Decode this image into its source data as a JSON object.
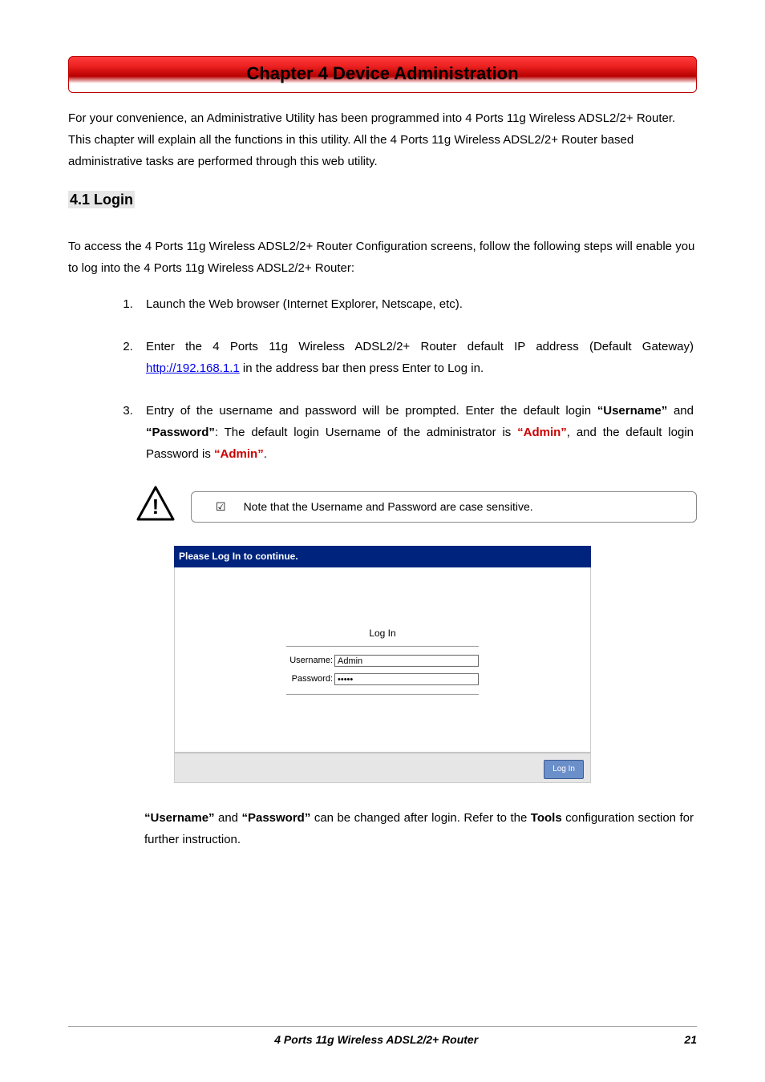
{
  "chapter_title": "Chapter 4 Device Administration",
  "intro_para": "For your convenience, an Administrative Utility has been programmed into 4 Ports 11g Wireless ADSL2/2+ Router. This chapter will explain all the functions in this utility. All the 4 Ports 11g Wireless ADSL2/2+ Router based administrative tasks are performed through this web utility.",
  "section_4_1_title": "4.1 Login",
  "section_4_1_intro": "To access the 4 Ports 11g Wireless ADSL2/2+ Router Configuration screens, follow the following steps will enable you to log into the 4 Ports 11g Wireless ADSL2/2+ Router:",
  "steps": {
    "s1": "Launch the Web browser (Internet Explorer, Netscape, etc).",
    "s2_pre": "Enter the 4 Ports 11g Wireless ADSL2/2+ Router default IP address (Default Gateway) ",
    "s2_link": "http://192.168.1.1",
    "s2_post": " in the address bar then press Enter to Log in.",
    "s3_pre": "Entry of the username and password will be prompted. Enter the default login ",
    "s3_username_q": "“Username”",
    "s3_mid1": " and ",
    "s3_password_q": "“Password”",
    "s3_mid2": ": The default login Username of the administrator is ",
    "s3_admin1": "“Admin”",
    "s3_mid3": ", and the default login Password is ",
    "s3_admin2": "“Admin”",
    "s3_end": "."
  },
  "note": {
    "check_glyph": "☑",
    "text": "Note that the Username and Password are case sensitive."
  },
  "screenshot": {
    "header": "Please Log In to continue.",
    "login_title": "Log In",
    "username_label": "Username:",
    "username_value": "Admin",
    "password_label": "Password:",
    "password_value": "•••••",
    "button": "Log In"
  },
  "post_screenshot": {
    "username_q": "“Username”",
    "mid1": " and ",
    "password_q": "“Password”",
    "mid2": " can be changed after login. Refer to the ",
    "tools": "Tools",
    "end": " configuration section for further instruction."
  },
  "footer": {
    "title": "4 Ports 11g Wireless ADSL2/2+ Router",
    "page": "21"
  }
}
